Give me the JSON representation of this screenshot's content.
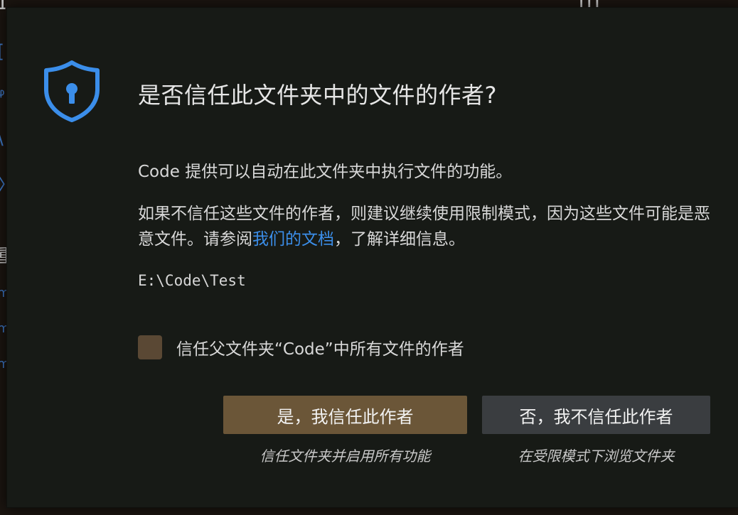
{
  "background": {
    "left_glyphs": [
      "[",
      "ᵠ",
      "\\",
      "〉",
      "重",
      "m",
      "m",
      "m"
    ],
    "top_left": "ɪ",
    "top_right": "ɪɪɪ"
  },
  "dialog": {
    "title": "是否信任此文件夹中的文件的作者?",
    "description": "Code 提供可以自动在此文件夹中执行文件的功能。",
    "warning": {
      "text_before_link": "如果不信任这些文件的作者，则建议继续使用限制模式，因为这些文件可能是恶意文件。请参阅",
      "link_text": "我们的文档",
      "text_after_link": "，了解详细信息。"
    },
    "folder_path": "E:\\Code\\Test",
    "checkbox": {
      "label": "信任父文件夹“Code”中所有文件的作者",
      "checked": false
    },
    "buttons": {
      "trust_label": "是，我信任此作者",
      "trust_caption": "信任文件夹并启用所有功能",
      "no_trust_label": "否，我不信任此作者",
      "no_trust_caption": "在受限模式下浏览文件夹"
    }
  },
  "colors": {
    "accent": "#3b8eea",
    "trust_button": "#6b5638",
    "no_trust_button": "#3a3d40",
    "checkbox": "#5a4834",
    "dialog_bg": "#171a16"
  },
  "icons": {
    "shield": "shield-lock-icon"
  }
}
